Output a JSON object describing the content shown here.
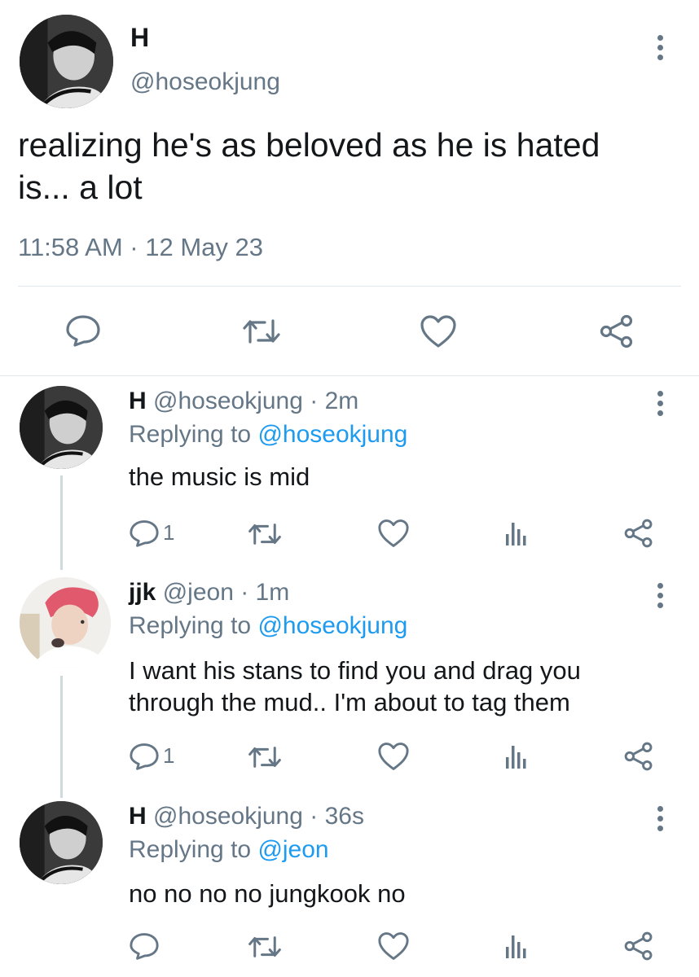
{
  "main_tweet": {
    "display_name": "H",
    "handle": "@hoseokjung",
    "text_line1": "realizing he's as beloved as he is hated",
    "text_line2": "is... a lot",
    "timestamp": "11:58 AM · 12 May 23"
  },
  "replies": [
    {
      "display_name": "H",
      "handle": "@hoseokjung",
      "time": "· 2m",
      "replying_label": "Replying to",
      "replying_to": "@hoseokjung",
      "text_line1": "the music is mid",
      "reply_count": "1"
    },
    {
      "display_name": "jjk",
      "handle": "@jeon",
      "time": "· 1m",
      "replying_label": "Replying to",
      "replying_to": "@hoseokjung",
      "text_line1": "I want his stans to find you and drag you",
      "text_line2": "through the mud.. I'm about to tag them",
      "reply_count": "1"
    },
    {
      "display_name": "H",
      "handle": "@hoseokjung",
      "time": "· 36s",
      "replying_label": "Replying to",
      "replying_to": "@jeon",
      "text_line1": "no no no no jungkook no",
      "reply_count": ""
    }
  ],
  "icons": {
    "reply": "comment-bubble-icon",
    "retweet": "retweet-icon",
    "like": "heart-icon",
    "share": "share-icon",
    "analytics": "analytics-bars-icon",
    "more": "more-vertical-icon"
  },
  "colors": {
    "text": "#14171a",
    "secondary": "#657786",
    "link": "#1d9bf0",
    "divider": "#e1e8ed"
  }
}
